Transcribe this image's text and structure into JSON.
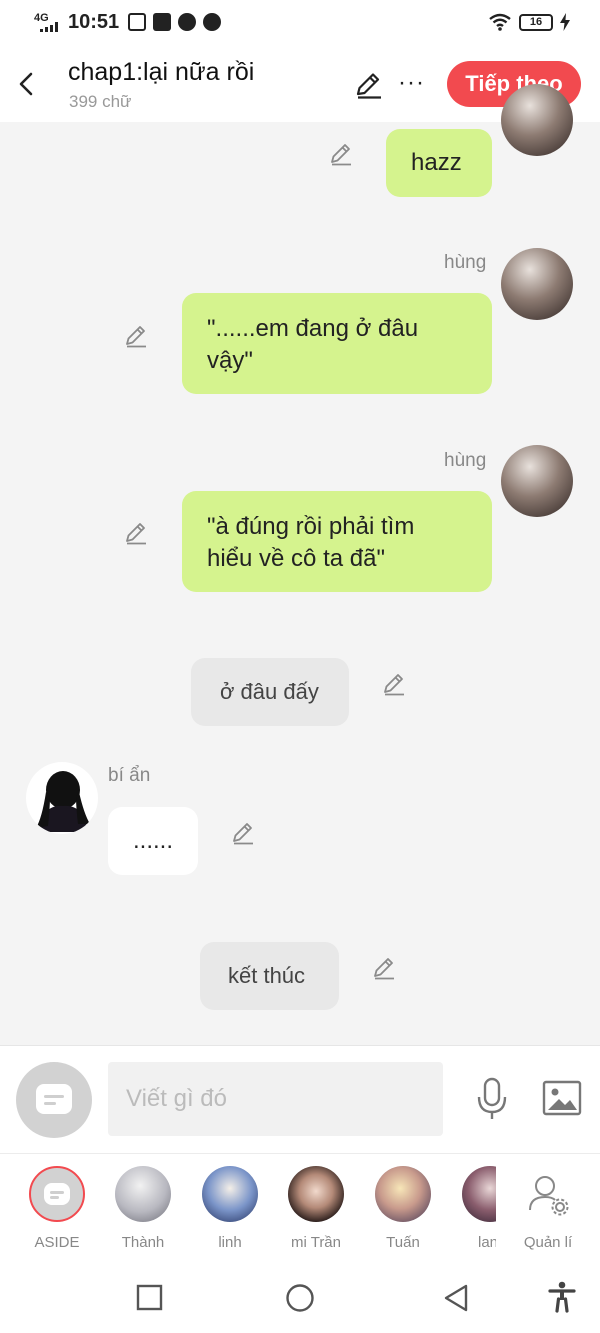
{
  "status_bar": {
    "network": "4G",
    "time": "10:51",
    "battery": "16"
  },
  "header": {
    "title": "chap1:lại nữa rồi",
    "word_count": "399 chữ",
    "next_label": "Tiếp theo",
    "more_label": "···"
  },
  "messages": [
    {
      "id": "m1",
      "side": "right",
      "speaker": "",
      "text": "hazz"
    },
    {
      "id": "m2",
      "side": "right",
      "speaker": "hùng",
      "line1": "\"......em đang ở đâu",
      "line2": "vậy\""
    },
    {
      "id": "m3",
      "side": "right",
      "speaker": "hùng",
      "line1": "\"à đúng rồi phải tìm",
      "line2": "hiểu về cô ta đã\""
    },
    {
      "id": "m4",
      "side": "center",
      "speaker": "",
      "text": "ở đâu đấy"
    },
    {
      "id": "m5",
      "side": "left",
      "speaker": "bí ẩn",
      "text": "......"
    },
    {
      "id": "m6",
      "side": "center",
      "speaker": "",
      "text": "kết thúc"
    }
  ],
  "composer": {
    "placeholder": "Viết gì đó"
  },
  "characters": [
    {
      "label": "ASIDE"
    },
    {
      "label": "Thành"
    },
    {
      "label": "linh"
    },
    {
      "label": "mi Trần"
    },
    {
      "label": "Tuấn"
    },
    {
      "label": "lan"
    },
    {
      "label": "Quản lí"
    }
  ],
  "colors": {
    "accent": "#f24a4f",
    "bubble_green": "#d5f38e",
    "bubble_grey": "#e8e8e8",
    "background": "#f4f4f4"
  }
}
